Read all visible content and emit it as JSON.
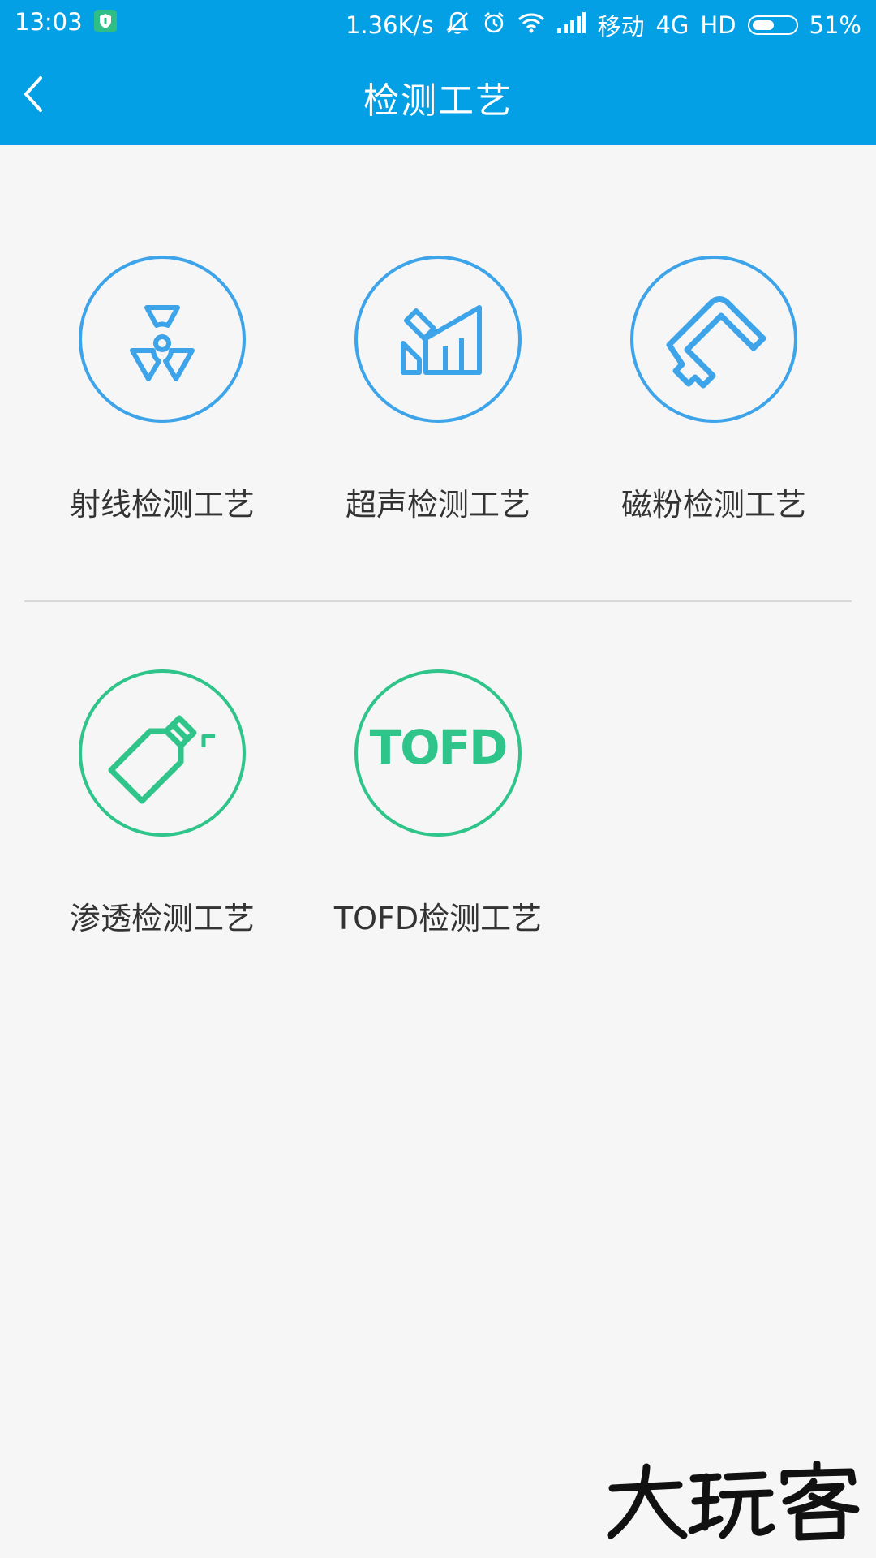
{
  "status_bar": {
    "time": "13:03",
    "speed": "1.36K/s",
    "carrier": "移动",
    "network": "4G",
    "hd": "HD",
    "battery": "51%",
    "battery_level": 0.51
  },
  "header": {
    "title": "检测工艺"
  },
  "grid": {
    "items": [
      {
        "label": "射线检测工艺",
        "icon": "radiation-icon",
        "color": "#3da4ea"
      },
      {
        "label": "超声检测工艺",
        "icon": "ultrasonic-icon",
        "color": "#3da4ea"
      },
      {
        "label": "磁粉检测工艺",
        "icon": "magnetic-yoke-icon",
        "color": "#3da4ea"
      },
      {
        "label": "渗透检测工艺",
        "icon": "spray-bottle-icon",
        "color": "#2ec48a"
      },
      {
        "label": "TOFD检测工艺",
        "icon": "tofd-icon",
        "icon_text": "TOFD",
        "color": "#2ec48a"
      }
    ]
  },
  "watermark": {
    "text": "大玩客"
  },
  "colors": {
    "header_bg": "#04a0e6",
    "blue_icon": "#3da4ea",
    "green_icon": "#2ec48a",
    "page_bg": "#f6f6f6"
  }
}
